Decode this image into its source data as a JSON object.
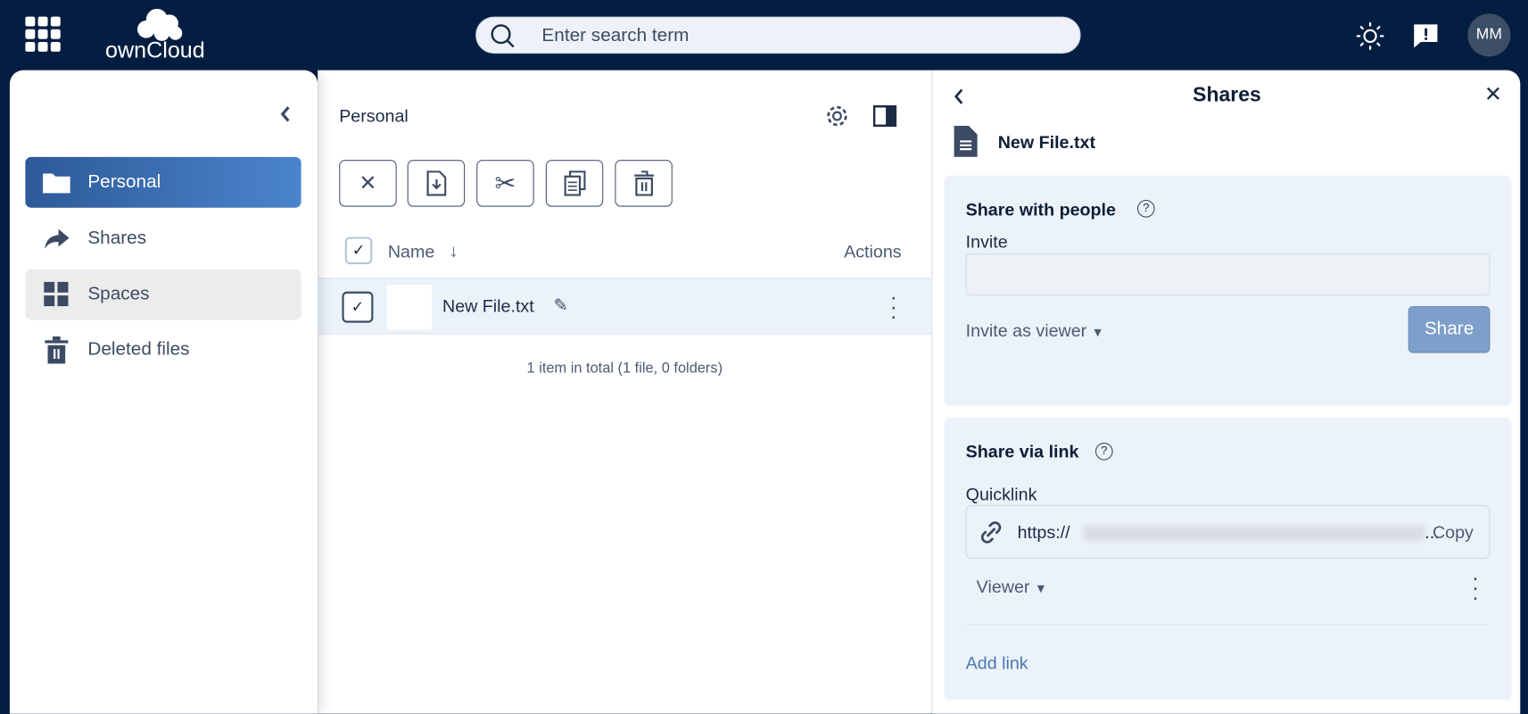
{
  "topbar": {
    "logo": "ownCloud",
    "search_placeholder": "Enter search term",
    "avatar_initials": "MM",
    "icons": [
      "app-grid-icon",
      "search-icon",
      "sun-icon",
      "feedback-icon"
    ]
  },
  "sidebar": {
    "items": [
      {
        "label": "Personal",
        "icon": "folder-icon",
        "active": true
      },
      {
        "label": "Shares",
        "icon": "share-icon"
      },
      {
        "label": "Spaces",
        "icon": "spaces-grid-icon"
      },
      {
        "label": "Deleted files",
        "icon": "trash-icon"
      }
    ]
  },
  "main": {
    "breadcrumb": "Personal",
    "col_name": "Name",
    "col_actions": "Actions",
    "rows": [
      {
        "name": "New File.txt",
        "selected": true
      }
    ],
    "footer": "1 item in total (1 file, 0 folders)"
  },
  "panel": {
    "title": "Shares",
    "file_name": "New File.txt",
    "people": {
      "heading": "Share with people",
      "invite_label": "Invite",
      "invite_value": "",
      "role": "Invite as viewer",
      "share_button": "Share"
    },
    "link": {
      "heading": "Share via link",
      "quicklink_label": "Quicklink",
      "url": "https://",
      "copy": "Copy",
      "ellipsis": "...",
      "role": "Viewer",
      "add_link": "Add link"
    }
  },
  "colors": {
    "header": "#041e42",
    "accent": "#4b84cc",
    "card": "#ebf2fa"
  }
}
